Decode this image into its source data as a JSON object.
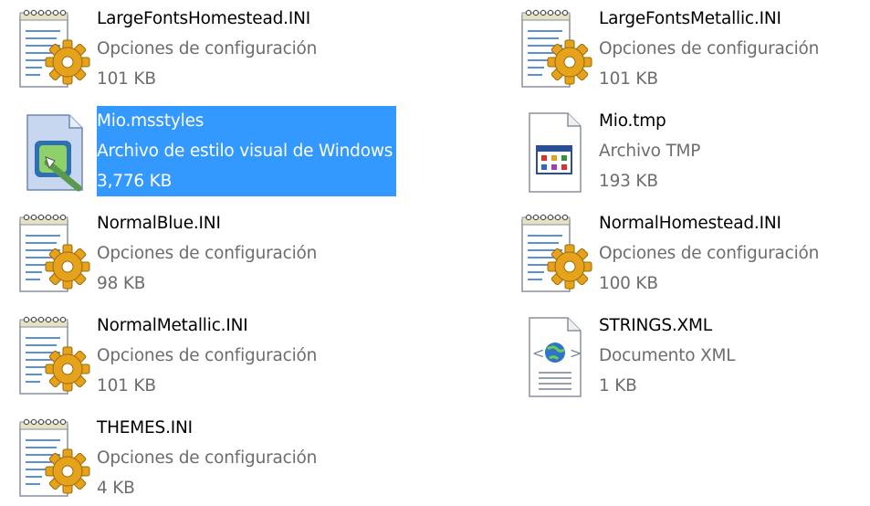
{
  "files": [
    {
      "name": "LargeFontsHomestead.INI",
      "type": "Opciones de configuración",
      "size": "101 KB",
      "icon": "ini-settings-icon"
    },
    {
      "name": "LargeFontsMetallic.INI",
      "type": "Opciones de configuración",
      "size": "101 KB",
      "icon": "ini-settings-icon"
    },
    {
      "name": "Mio.msstyles",
      "type": "Archivo de estilo visual de Windows",
      "size": "3,776 KB",
      "icon": "msstyles-icon",
      "selected": true
    },
    {
      "name": "Mio.tmp",
      "type": "Archivo TMP",
      "size": "193 KB",
      "icon": "tmp-file-icon"
    },
    {
      "name": "NormalBlue.INI",
      "type": "Opciones de configuración",
      "size": "98 KB",
      "icon": "ini-settings-icon"
    },
    {
      "name": "NormalHomestead.INI",
      "type": "Opciones de configuración",
      "size": "100 KB",
      "icon": "ini-settings-icon"
    },
    {
      "name": "NormalMetallic.INI",
      "type": "Opciones de configuración",
      "size": "101 KB",
      "icon": "ini-settings-icon"
    },
    {
      "name": "STRINGS.XML",
      "type": "Documento XML",
      "size": "1 KB",
      "icon": "xml-document-icon"
    },
    {
      "name": "THEMES.INI",
      "type": "Opciones de configuración",
      "size": "4 KB",
      "icon": "ini-settings-icon"
    }
  ],
  "colors": {
    "selection": "#3399ff",
    "secondary_text": "#6d6d6d"
  }
}
